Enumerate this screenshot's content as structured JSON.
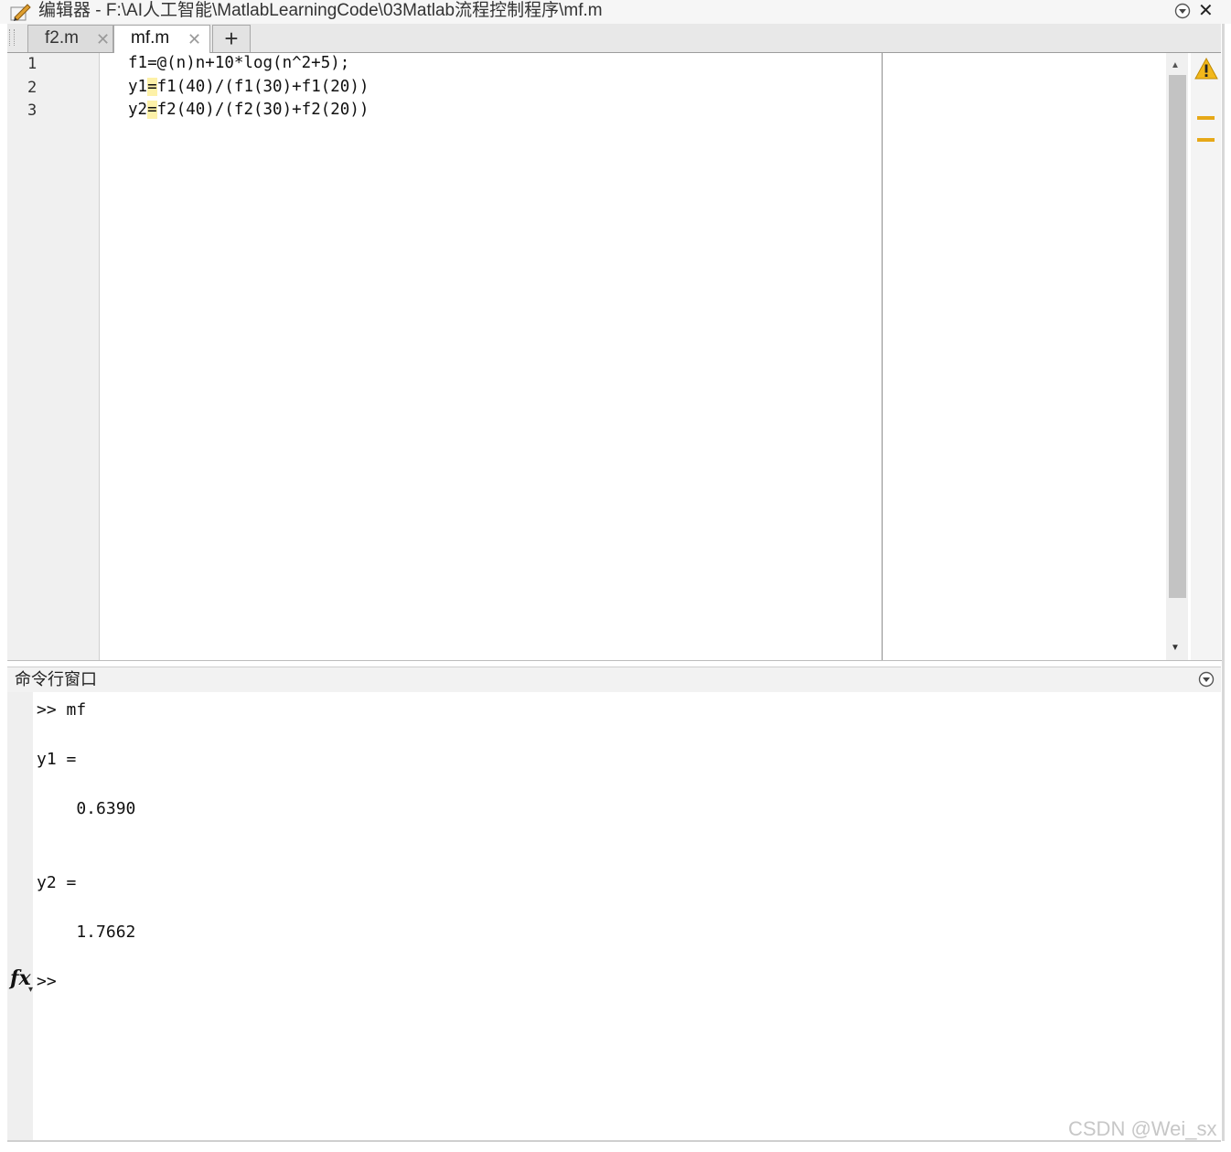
{
  "window": {
    "title": "编辑器 - F:\\AI人工智能\\MatlabLearningCode\\03Matlab流程控制程序\\mf.m",
    "close_symbol": "✕"
  },
  "tabs": [
    {
      "label": "f2.m",
      "active": false
    },
    {
      "label": "mf.m",
      "active": true
    }
  ],
  "tab_close_symbol": "✕",
  "add_tab_symbol": "+",
  "editor": {
    "lines": [
      {
        "number": "1",
        "text": "f1=@(n)n+10*log(n^2+5);"
      },
      {
        "number": "2",
        "pre": "y1",
        "eq": "=",
        "post": "f1(40)/(f1(30)+f1(20))"
      },
      {
        "number": "3",
        "pre": "y2",
        "eq": "=",
        "post": "f2(40)/(f2(30)+f2(20))"
      }
    ],
    "warning_count": 2,
    "warning_color": "#e6a817"
  },
  "command_window": {
    "title": "命令行窗口",
    "lines": [
      ">> mf",
      "y1 =",
      "    0.6390",
      "y2 =",
      "    1.7662"
    ],
    "prompt": ">>",
    "fx_label": "fx"
  },
  "watermark": "CSDN @Wei_sx"
}
